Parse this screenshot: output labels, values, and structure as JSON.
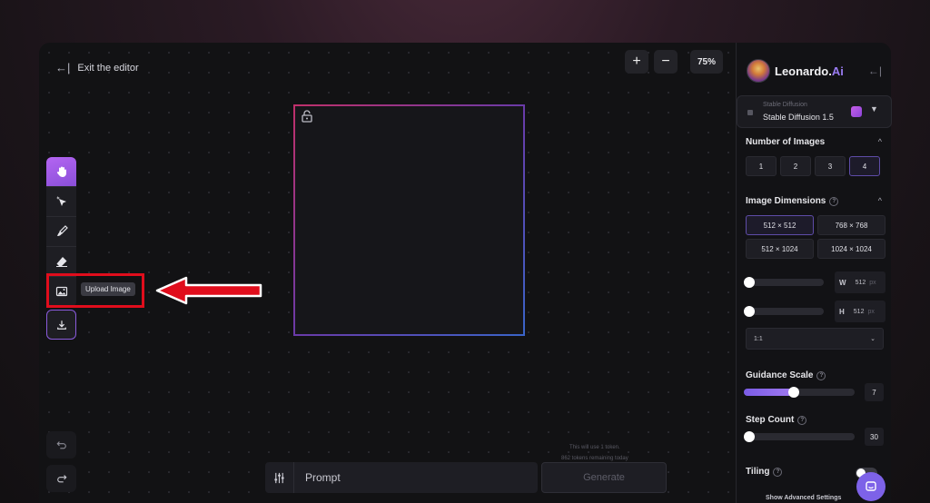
{
  "editor": {
    "exit_label": "Exit the editor",
    "zoom_in": "+",
    "zoom_out": "−",
    "zoom_level": "75%",
    "tooltip": "Upload Image",
    "prompt_placeholder": "Prompt",
    "generate_label": "Generate",
    "token_line1": "This will use 1 token.",
    "token_line2": "862 tokens remaining today"
  },
  "sidebar": {
    "brand": "Leonardo.",
    "brand_suffix": "Ai",
    "model_sub": "Stable Diffusion",
    "model_name": "Stable Diffusion 1.5",
    "num_images_title": "Number of Images",
    "num_options": [
      "1",
      "2",
      "3",
      "4"
    ],
    "num_selected": "4",
    "dimensions_title": "Image Dimensions",
    "dimension_options": [
      "512 × 512",
      "768 × 768",
      "512 × 1024",
      "1024 × 1024"
    ],
    "width_label": "W",
    "width_value": "512",
    "height_label": "H",
    "height_value": "512",
    "unit": "px",
    "ratio": "1:1",
    "guidance_title": "Guidance Scale",
    "guidance_value": "7",
    "guidance_level": 0.45,
    "step_title": "Step Count",
    "step_value": "30",
    "tiling_title": "Tiling",
    "advanced_label": "Show Advanced Settings"
  },
  "colors": {
    "accent": "#8b5cf6",
    "highlight": "#e00d1c"
  }
}
